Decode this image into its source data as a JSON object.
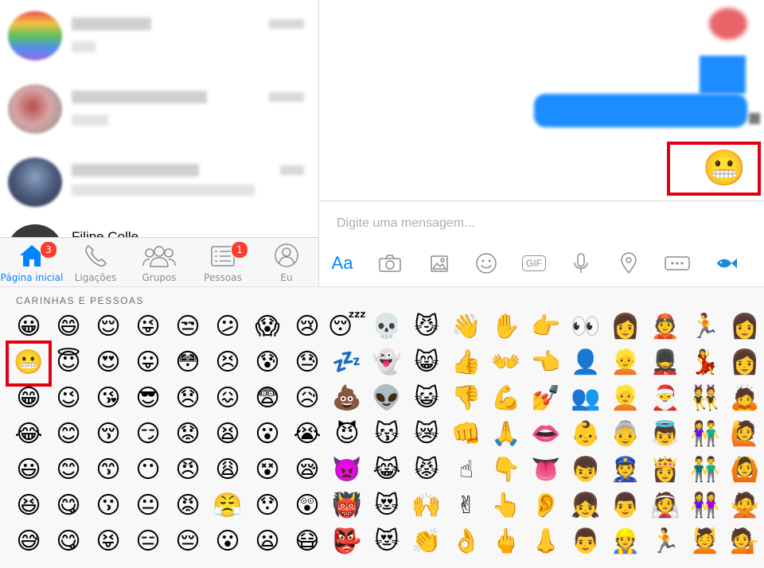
{
  "app": "Messenger",
  "conversations": [
    {
      "name_text": "",
      "snippet": "",
      "avatar_colors": [
        "#e84d4d",
        "#f6c343",
        "#5cc15c",
        "#4f8ef0",
        "#a06be0"
      ]
    },
    {
      "name_text": "",
      "snippet": "",
      "avatar_colors": [
        "#d6a6a6",
        "#b94c4c",
        "#8c8c8c"
      ]
    },
    {
      "name_text": "",
      "snippet": "",
      "avatar_colors": [
        "#4a5a7a",
        "#8aa0c2",
        "#2d3344"
      ]
    },
    {
      "name_text": "Filipe Colle",
      "snippet": ""
    }
  ],
  "tabbar": {
    "tabs": [
      {
        "label": "Página inicial",
        "icon": "home-icon",
        "badge": "3",
        "active": true
      },
      {
        "label": "Ligações",
        "icon": "phone-icon",
        "badge": "",
        "active": false
      },
      {
        "label": "Grupos",
        "icon": "group-icon",
        "badge": "",
        "active": false
      },
      {
        "label": "Pessoas",
        "icon": "list-icon",
        "badge": "1",
        "active": false
      },
      {
        "label": "Eu",
        "icon": "profile-icon",
        "badge": "",
        "active": false
      }
    ]
  },
  "chat": {
    "sent_emoji": "😬",
    "input_placeholder": "Digite uma mensagem...",
    "accent": "#0084ff",
    "toolbar": [
      {
        "name": "text-format-button",
        "label": "Aa"
      },
      {
        "name": "camera-icon"
      },
      {
        "name": "gallery-icon"
      },
      {
        "name": "emoji-icon"
      },
      {
        "name": "gif-icon",
        "label": "GIF"
      },
      {
        "name": "microphone-icon"
      },
      {
        "name": "location-icon"
      },
      {
        "name": "more-icon"
      },
      {
        "name": "fish-icon"
      }
    ]
  },
  "emoji_panel": {
    "section_title": "CARINHAS E PESSOAS",
    "selected": "😬",
    "rows": [
      [
        "😀",
        "😄",
        "😌",
        "😜",
        "😒",
        "😕",
        "😱",
        "😢",
        "😴",
        "💀",
        "😼",
        "👋",
        "✋",
        "👉",
        "👀",
        "👩",
        "👲",
        "🏃",
        "👩"
      ],
      [
        "😬",
        "😇",
        "😍",
        "😛",
        "😳",
        "😣",
        "😰",
        "😓",
        "💤",
        "👻",
        "😸",
        "👍",
        "👐",
        "👈",
        "👤",
        "👱",
        "💂",
        "💃",
        "👩"
      ],
      [
        "😁",
        "😉",
        "😘",
        "😎",
        "😞",
        "😖",
        "😨",
        "😥",
        "💩",
        "👽",
        "😺",
        "👎",
        "💪",
        "💅",
        "👥",
        "👱",
        "🎅",
        "👯",
        "🙇"
      ],
      [
        "😂",
        "😊",
        "😚",
        "😏",
        "😟",
        "😫",
        "😮",
        "😭",
        "😈",
        "😽",
        "😿",
        "👊",
        "🙏",
        "👄",
        "👶",
        "👵",
        "👼",
        "👫",
        "🙋"
      ],
      [
        "😃",
        "😊",
        "😙",
        "😶",
        "😠",
        "😩",
        "😵",
        "😪",
        "👿",
        "😹",
        "😾",
        "☝",
        "👇",
        "👅",
        "👦",
        "👮",
        "👸",
        "👬",
        "🙆"
      ],
      [
        "😆",
        "😋",
        "😗",
        "😐",
        "😡",
        "😤",
        "😯",
        "😲",
        "👹",
        "😻",
        "🙌",
        "✌",
        "👆",
        "👂",
        "👧",
        "👨",
        "👰",
        "👭",
        "🙅"
      ],
      [
        "😅",
        "😋",
        "😝",
        "😑",
        "😔",
        "😮",
        "😦",
        "😷",
        "👺",
        "😻",
        "👏",
        "👌",
        "🖕",
        "👃",
        "👨",
        "👷",
        "🏃",
        "💆",
        "💁"
      ]
    ]
  }
}
